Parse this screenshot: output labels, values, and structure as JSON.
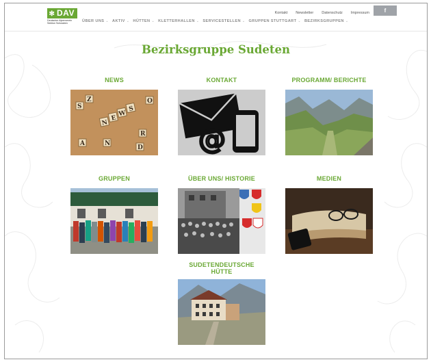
{
  "header": {
    "logo": {
      "mark": "DAV",
      "subtitle_line1": "Deutscher Alpenverein",
      "subtitle_line2": "Sektion Schwaben"
    },
    "top_links": [
      "Kontakt",
      "Newsletter",
      "Datenschutz",
      "Impressum"
    ],
    "facebook_label": "f",
    "main_nav": [
      {
        "label": "ÜBER UNS"
      },
      {
        "label": "AKTIV"
      },
      {
        "label": "HÜTTEN"
      },
      {
        "label": "KLETTERHALLEN"
      },
      {
        "label": "SERVICESTELLEN"
      },
      {
        "label": "GRUPPEN STUTTGART"
      },
      {
        "label": "BEZIRKSGRUPPEN"
      }
    ],
    "chevron": "⌄"
  },
  "page": {
    "title": "Bezirksgruppe Sudeten"
  },
  "tiles": [
    {
      "label": "NEWS",
      "image": "news-scrabble-photo"
    },
    {
      "label": "KONTAKT",
      "image": "envelope-at-phone-icon"
    },
    {
      "label": "PROGRAMM/ BERICHTE",
      "image": "alpine-valley-photo"
    },
    {
      "label": "GRUPPEN",
      "image": "group-photo"
    },
    {
      "label": "ÜBER UNS/ HISTORIE",
      "image": "history-photo-with-crests"
    },
    {
      "label": "MEDIEN",
      "image": "books-glasses-phone-photo"
    },
    {
      "label_line1": "SUDETENDEUTSCHE",
      "label_line2": "HÜTTE",
      "image": "mountain-hut-photo"
    }
  ],
  "colors": {
    "accent": "#6aa834",
    "nav_text": "#8a8a8a",
    "facebook_button": "#9fa3a8"
  }
}
